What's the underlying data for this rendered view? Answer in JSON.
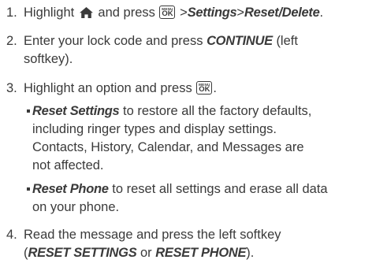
{
  "steps": [
    {
      "num": "1.",
      "t1": "Highlight",
      "t2": "and press",
      "t3": ">",
      "settings": "Settings",
      "t4": ">",
      "reset_delete": "Reset/Delete",
      "t5": "."
    },
    {
      "num": "2.",
      "t1": "Enter your lock code and press",
      "continue": "CONTINUE",
      "t2": "(left",
      "line2": "softkey)."
    },
    {
      "num": "3.",
      "t1": "Highlight an option and press",
      "t2": "."
    },
    {
      "num": "4.",
      "line1": "Read the message and press the left softkey",
      "open": "(",
      "reset_settings": "RESET SETTINGS",
      "or": "or",
      "reset_phone": "RESET PHONE",
      "close": ")."
    }
  ],
  "bullets": [
    {
      "label": "Reset Settings",
      "l1": "to restore all the factory defaults,",
      "l2": "including ringer types and display settings.",
      "l3": "Contacts, History, Calendar, and Messages are",
      "l4": "not affected."
    },
    {
      "label": "Reset Phone",
      "l1": "to reset all settings and erase all data",
      "l2": "on your phone."
    }
  ],
  "menu_ok_key": {
    "top": "MENU",
    "bottom": "OK"
  },
  "icons": {
    "home": "home-icon",
    "menu_ok": "menu-ok-key-icon"
  },
  "colors": {
    "text": "#3a3a3a",
    "background": "#ffffff"
  }
}
